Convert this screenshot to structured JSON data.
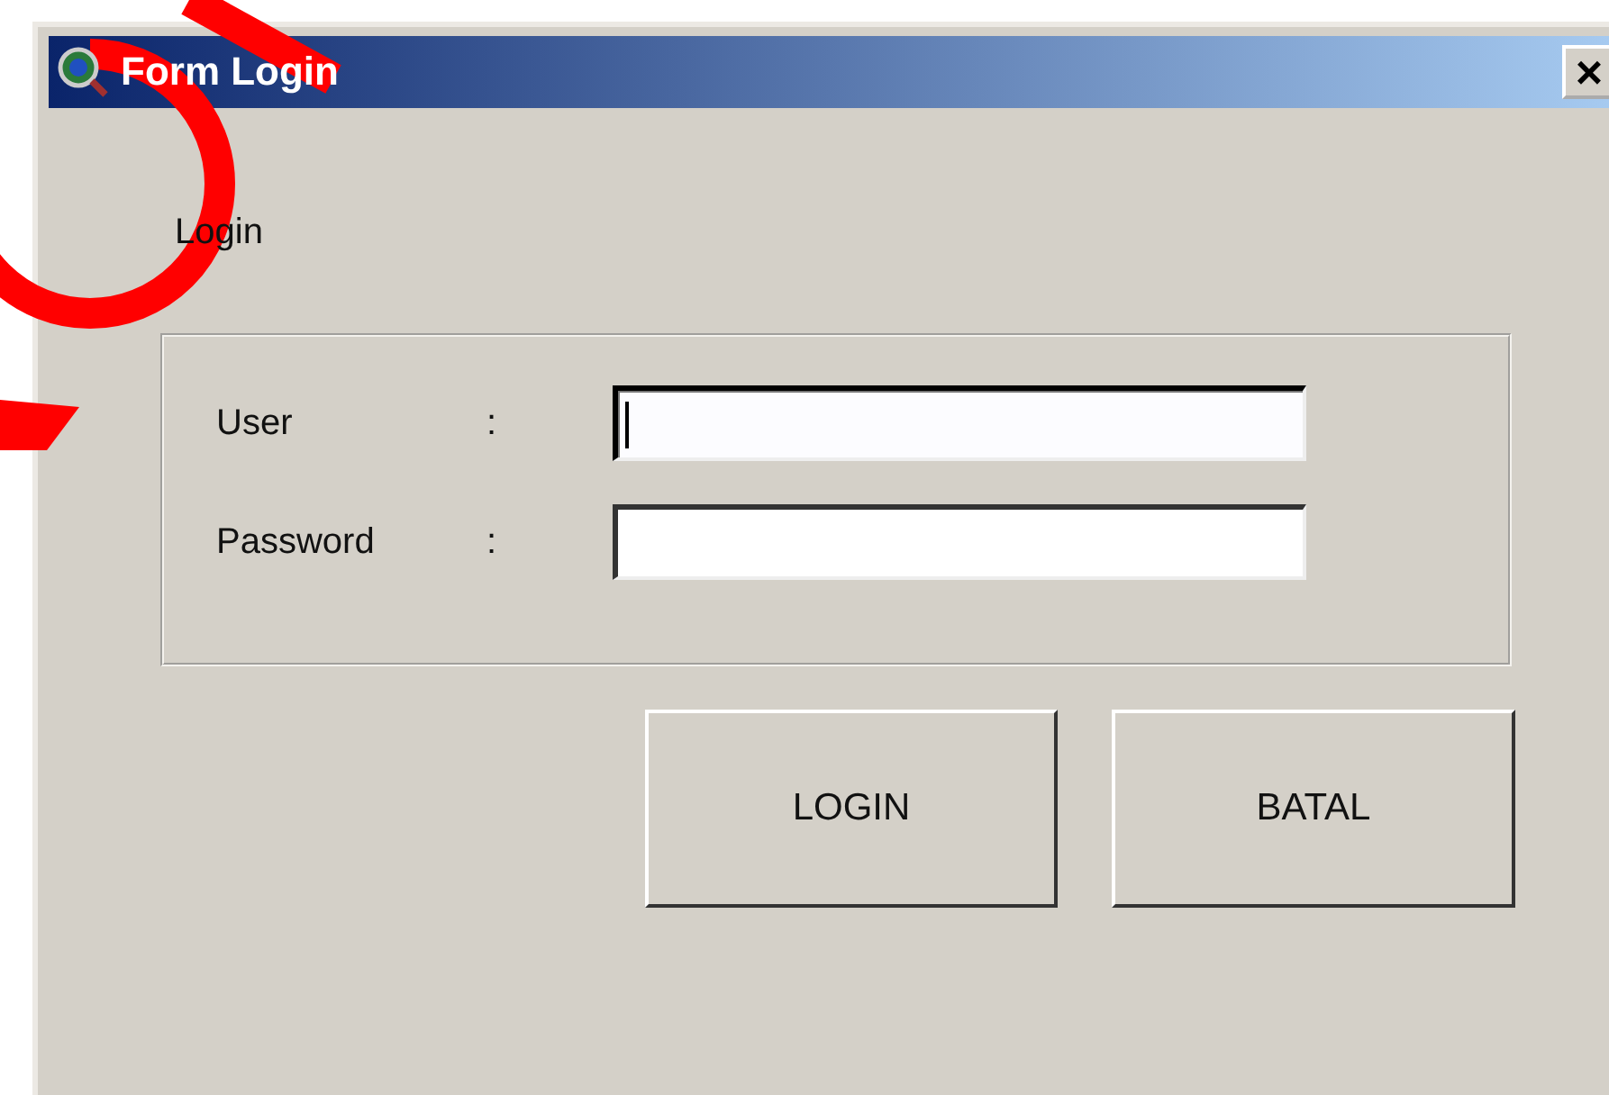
{
  "window": {
    "title": "Form Login",
    "close": "×"
  },
  "heading": "Login",
  "fields": [
    {
      "label": "User",
      "separator": ":",
      "focused": true
    },
    {
      "label": "Password",
      "separator": ":",
      "focused": false
    }
  ],
  "buttons": [
    "LOGIN",
    "BATAL"
  ]
}
